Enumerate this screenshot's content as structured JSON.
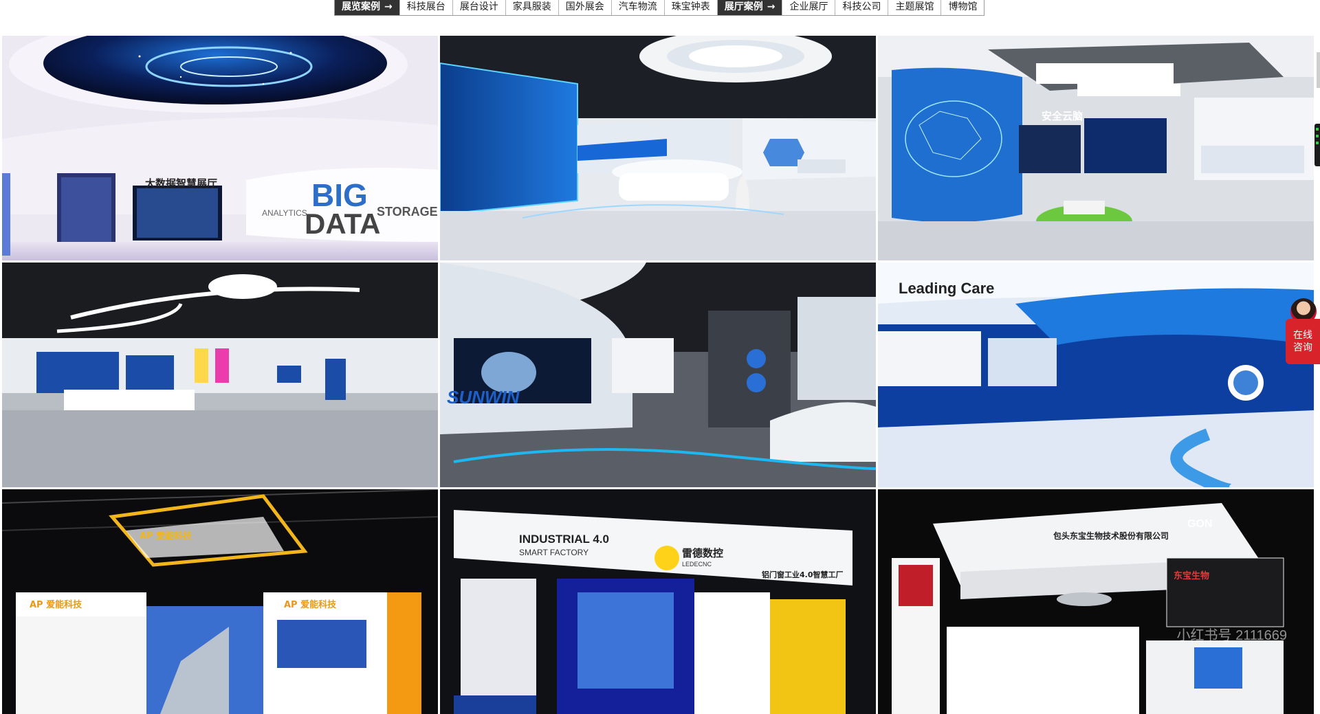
{
  "nav": {
    "categories": [
      {
        "label": "展览案例",
        "arrow": "→",
        "active": true
      },
      {
        "label": "科技展台",
        "arrow": "",
        "active": false
      },
      {
        "label": "展台设计",
        "arrow": "",
        "active": false
      },
      {
        "label": "家具服装",
        "arrow": "",
        "active": false
      },
      {
        "label": "国外展会",
        "arrow": "",
        "active": false
      },
      {
        "label": "汽车物流",
        "arrow": "",
        "active": false
      },
      {
        "label": "珠宝钟表",
        "arrow": "",
        "active": false
      },
      {
        "label": "展厅案例",
        "arrow": "→",
        "active": true
      },
      {
        "label": "企业展厅",
        "arrow": "",
        "active": false
      },
      {
        "label": "科技公司",
        "arrow": "",
        "active": false
      },
      {
        "label": "主题展馆",
        "arrow": "",
        "active": false
      },
      {
        "label": "博物馆",
        "arrow": "",
        "active": false
      }
    ]
  },
  "tiles": [
    {
      "id": "bigdata-hall",
      "signage": [
        "大数据智慧展厅",
        "BIG",
        "DATA",
        "ANALYTICS",
        "STORAGE"
      ]
    },
    {
      "id": "reception-hall",
      "signage": []
    },
    {
      "id": "cloud-hall",
      "signage": [
        "安全云脑"
      ]
    },
    {
      "id": "product-hall",
      "signage": []
    },
    {
      "id": "sunwin-hall",
      "signage": [
        "SUNWIN"
      ]
    },
    {
      "id": "leading-care-hall",
      "signage": [
        "Leading Care"
      ]
    },
    {
      "id": "ap-booth",
      "signage": [
        "AP 爱能科技"
      ]
    },
    {
      "id": "ledecnc-booth",
      "signage": [
        "INDUSTRIAL 4.0",
        "SMART FACTORY",
        "雷德数控",
        "LEDECNC",
        "铝门窗工业4.0智慧工厂"
      ]
    },
    {
      "id": "dongbao-booth",
      "signage": [
        "包头东宝生物技术股份有限公司",
        "GON",
        "东宝生物"
      ]
    }
  ],
  "consult": {
    "lines": [
      "在线",
      "咨询"
    ]
  },
  "corner_watermark": "小红书号 2111669"
}
